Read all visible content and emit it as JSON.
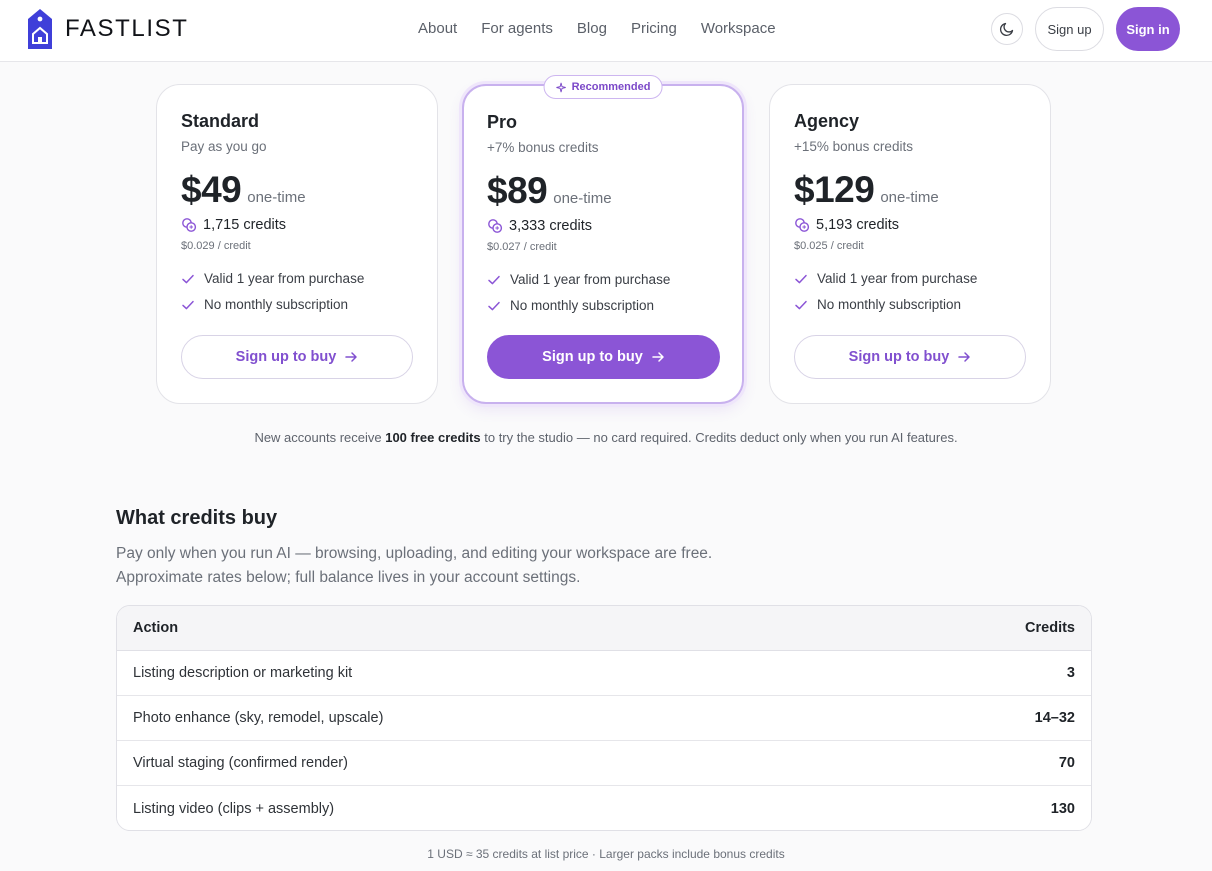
{
  "brand": {
    "name": "FASTLIST",
    "accent": "#8b55d6"
  },
  "nav": {
    "items": [
      "About",
      "For agents",
      "Blog",
      "Pricing",
      "Workspace"
    ],
    "theme_icon": "moon-icon",
    "signup_label": "Sign up",
    "signin_label": "Sign in"
  },
  "plans": [
    {
      "name": "Standard",
      "subtitle": "Pay as you go",
      "price": "$49",
      "price_note": "one-time",
      "credits": "1,715 credits",
      "per_credit": "$0.029 / credit",
      "features": [
        "Valid 1 year from purchase",
        "No monthly subscription"
      ],
      "cta": "Sign up to buy",
      "featured": false
    },
    {
      "name": "Pro",
      "subtitle": "+7% bonus credits",
      "price": "$89",
      "price_note": "one-time",
      "credits": "3,333 credits",
      "per_credit": "$0.027 / credit",
      "features": [
        "Valid 1 year from purchase",
        "No monthly subscription"
      ],
      "cta": "Sign up to buy",
      "featured": true,
      "badge": "Recommended"
    },
    {
      "name": "Agency",
      "subtitle": "+15% bonus credits",
      "price": "$129",
      "price_note": "one-time",
      "credits": "5,193 credits",
      "per_credit": "$0.025 / credit",
      "features": [
        "Valid 1 year from purchase",
        "No monthly subscription"
      ],
      "cta": "Sign up to buy",
      "featured": false
    }
  ],
  "free_note": {
    "before": "New accounts receive ",
    "bold": "100 free credits",
    "after": " to try the studio — no card required. Credits deduct only when you run AI features."
  },
  "credits_section": {
    "title": "What credits buy",
    "desc_line1": "Pay only when you run AI — browsing, uploading, and editing your workspace are free.",
    "desc_line2": "Approximate rates below; full balance lives in your account settings.",
    "columns": [
      "Action",
      "Credits"
    ],
    "rows": [
      {
        "action": "Listing description or marketing kit",
        "credits": "3"
      },
      {
        "action": "Photo enhance (sky, remodel, upscale)",
        "credits": "14–32"
      },
      {
        "action": "Virtual staging (confirmed render)",
        "credits": "70"
      },
      {
        "action": "Listing video (clips + assembly)",
        "credits": "130"
      }
    ],
    "footnote": "1 USD ≈ 35 credits at list price · Larger packs include bonus credits"
  }
}
